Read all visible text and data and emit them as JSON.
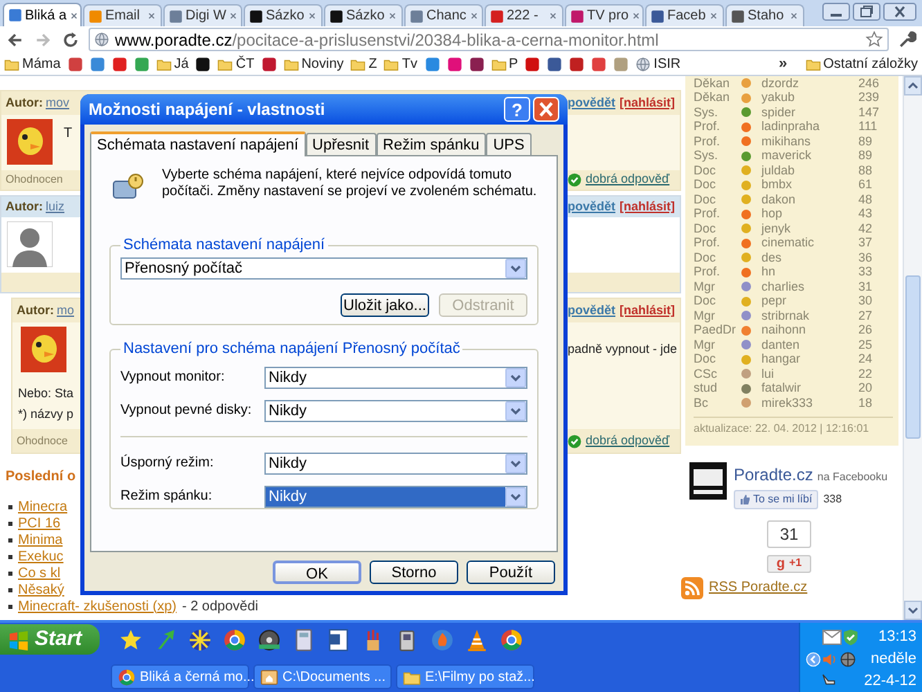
{
  "browser": {
    "tabs": [
      {
        "label": "Bliká a",
        "selected": true,
        "color": "#3a7bd5"
      },
      {
        "label": "Email",
        "selected": false,
        "color": "#f08a00"
      },
      {
        "label": "Digi W",
        "selected": false,
        "color": "#6d7f99"
      },
      {
        "label": "Sázko",
        "selected": false,
        "color": "#111111"
      },
      {
        "label": "Sázko",
        "selected": false,
        "color": "#111111"
      },
      {
        "label": "Chanc",
        "selected": false,
        "color": "#6d7f99"
      },
      {
        "label": "222 -",
        "selected": false,
        "color": "#d42020"
      },
      {
        "label": "TV pro",
        "selected": false,
        "color": "#c0186a"
      },
      {
        "label": "Faceb",
        "selected": false,
        "color": "#3b5998"
      },
      {
        "label": "Staho",
        "selected": false,
        "color": "#555555"
      }
    ],
    "address_host": "www.poradte.cz",
    "address_path": "/pocitace-a-prislusenstvi/20384-blika-a-cerna-monitor.html",
    "bookmarks": [
      {
        "kind": "folder",
        "label": "Máma"
      },
      {
        "kind": "favicon",
        "color": "#d04040"
      },
      {
        "kind": "favicon",
        "color": "#3a8ad8"
      },
      {
        "kind": "favicon",
        "color": "#e02020"
      },
      {
        "kind": "favicon",
        "color": "#34a853"
      },
      {
        "kind": "folder",
        "label": "Já"
      },
      {
        "kind": "favicon",
        "color": "#111111"
      },
      {
        "kind": "folder",
        "label": "ČT"
      },
      {
        "kind": "favicon",
        "color": "#c01830"
      },
      {
        "kind": "folder",
        "label": "Noviny"
      },
      {
        "kind": "folder",
        "label": "Z"
      },
      {
        "kind": "folder",
        "label": "Tv"
      },
      {
        "kind": "favicon",
        "color": "#2a8ae0"
      },
      {
        "kind": "favicon",
        "color": "#e0107a"
      },
      {
        "kind": "favicon",
        "color": "#8a2050"
      },
      {
        "kind": "folder",
        "label": "P"
      },
      {
        "kind": "favicon",
        "color": "#d01010"
      },
      {
        "kind": "favicon",
        "color": "#3b5998"
      },
      {
        "kind": "favicon",
        "color": "#c02020"
      },
      {
        "kind": "favicon",
        "color": "#e04040"
      },
      {
        "kind": "favicon",
        "color": "#b0a080"
      },
      {
        "kind": "site",
        "label": "ISIR"
      }
    ],
    "more": "»",
    "other_bookmarks": "Ostatní záložky"
  },
  "posts": [
    {
      "kind": "beige",
      "indented": false,
      "author_label": "Autor:",
      "author": "mov",
      "reply": "povědět",
      "report": "[nahlásit]",
      "avatar": {
        "kind": "bird"
      },
      "avatar_text": "T",
      "rating": "Ohodnocen",
      "good_answer": "dobrá odpověď"
    },
    {
      "kind": "blue",
      "indented": false,
      "author_label": "Autor:",
      "author": "luiz",
      "reply": "povědět",
      "report": "[nahlásit]",
      "avatar": {
        "kind": "person"
      }
    },
    {
      "kind": "beige",
      "indented": true,
      "author_label": "Autor:",
      "author": "mo",
      "reply": "povědět",
      "report": "[nahlásit]",
      "avatar": {
        "kind": "bird"
      },
      "right_text": "padně vypnout - jde",
      "lines": [
        "Nebo: Sta",
        "*) názvy p"
      ],
      "rating": "Ohodnoce",
      "good_answer": "dobrá odpověď"
    }
  ],
  "latest": {
    "heading": "Poslední o",
    "items": [
      {
        "label": "Minecra"
      },
      {
        "label": "PCI 16"
      },
      {
        "label": "Minima"
      },
      {
        "label": "Exekuc"
      },
      {
        "label": "Co s kl"
      },
      {
        "label": "Něsaký"
      },
      {
        "label": "Minecraft- zkušenosti (xp)",
        "suffix": "- 2 odpovědi"
      }
    ]
  },
  "sidebar": {
    "leaders": [
      {
        "rank": "Děkan",
        "name": "dzordz",
        "points": "246",
        "color": "#e8a040"
      },
      {
        "rank": "Děkan",
        "name": "yakub",
        "points": "239",
        "color": "#e8a040"
      },
      {
        "rank": "Sys.",
        "name": "spider",
        "points": "147",
        "color": "#5a9a30"
      },
      {
        "rank": "Prof.",
        "name": "ladinpraha",
        "points": "111",
        "color": "#f07020"
      },
      {
        "rank": "Prof.",
        "name": "mikihans",
        "points": "89",
        "color": "#f07020"
      },
      {
        "rank": "Sys.",
        "name": "maverick",
        "points": "89",
        "color": "#5a9a30"
      },
      {
        "rank": "Doc",
        "name": "juldab",
        "points": "88",
        "color": "#e0b020"
      },
      {
        "rank": "Doc",
        "name": "bmbx",
        "points": "61",
        "color": "#e0b020"
      },
      {
        "rank": "Doc",
        "name": "dakon",
        "points": "48",
        "color": "#e0b020"
      },
      {
        "rank": "Prof.",
        "name": "hop",
        "points": "43",
        "color": "#f07020"
      },
      {
        "rank": "Doc",
        "name": "jenyk",
        "points": "42",
        "color": "#e0b020"
      },
      {
        "rank": "Prof.",
        "name": "cinematic",
        "points": "37",
        "color": "#f07020"
      },
      {
        "rank": "Doc",
        "name": "des",
        "points": "36",
        "color": "#e0b020"
      },
      {
        "rank": "Prof.",
        "name": "hn",
        "points": "33",
        "color": "#f07020"
      },
      {
        "rank": "Mgr",
        "name": "charlies",
        "points": "31",
        "color": "#9090c8"
      },
      {
        "rank": "Doc",
        "name": "pepr",
        "points": "30",
        "color": "#e0b020"
      },
      {
        "rank": "Mgr",
        "name": "stribrnak",
        "points": "27",
        "color": "#9090c8"
      },
      {
        "rank": "PaedDr",
        "name": "naihonn",
        "points": "26",
        "color": "#f08030"
      },
      {
        "rank": "Mgr",
        "name": "danten",
        "points": "25",
        "color": "#9090c8"
      },
      {
        "rank": "Doc",
        "name": "hangar",
        "points": "24",
        "color": "#e0b020"
      },
      {
        "rank": "CSc",
        "name": "lui",
        "points": "22",
        "color": "#c0a080"
      },
      {
        "rank": "stud",
        "name": "fatalwir",
        "points": "20",
        "color": "#808060"
      },
      {
        "rank": "Bc",
        "name": "mirek333",
        "points": "18",
        "color": "#d0a070"
      }
    ],
    "updated": "aktualizace: 22. 04. 2012 | 12:16:01",
    "facebook": {
      "page": "Poradte.cz",
      "suffix": "na Facebooku",
      "like": "To se mi líbí",
      "likes": "338"
    },
    "plus_count": "31",
    "plus_glyph": "g",
    "plus_label": "+1",
    "rss": "RSS Poradte.cz"
  },
  "dialog": {
    "title": "Možnosti napájení - vlastnosti",
    "help": "?",
    "tabs": [
      {
        "label": "Schémata nastavení napájení",
        "selected": true
      },
      {
        "label": "Upřesnit",
        "selected": false
      },
      {
        "label": "Režim spánku",
        "selected": false
      },
      {
        "label": "UPS",
        "selected": false
      }
    ],
    "description": "Vyberte schéma napájení, které nejvíce odpovídá tomuto počítači. Změny nastavení se projeví ve zvoleném schématu.",
    "scheme_group": {
      "legend": "Schémata nastavení napájení",
      "value": "Přenosný počítač",
      "buttons": [
        {
          "label": "Uložit jako...",
          "disabled": false
        },
        {
          "label": "Odstranit",
          "disabled": true
        }
      ]
    },
    "settings_group": {
      "legend": "Nastavení pro schéma napájení Přenosný počítač",
      "rows": [
        {
          "label": "Vypnout monitor:",
          "value": "Nikdy",
          "focused": false
        },
        {
          "label": "Vypnout pevné disky:",
          "value": "Nikdy",
          "focused": false
        },
        {
          "label": "Úsporný režim:",
          "value": "Nikdy",
          "focused": false
        },
        {
          "label": "Režim spánku:",
          "value": "Nikdy",
          "focused": true
        }
      ]
    },
    "buttons": [
      {
        "label": "OK",
        "default": true
      },
      {
        "label": "Storno",
        "default": false
      },
      {
        "label": "Použít",
        "default": false
      }
    ]
  },
  "taskbar": {
    "start": "Start",
    "tasks": [
      {
        "label": "Bliká a černá mo...",
        "kind": "browser"
      },
      {
        "label": "C:\\Documents ...",
        "kind": "window"
      },
      {
        "label": "E:\\Filmy po staž...",
        "kind": "folder"
      }
    ],
    "time": "13:13",
    "day": "neděle",
    "date": "22-4-12"
  }
}
